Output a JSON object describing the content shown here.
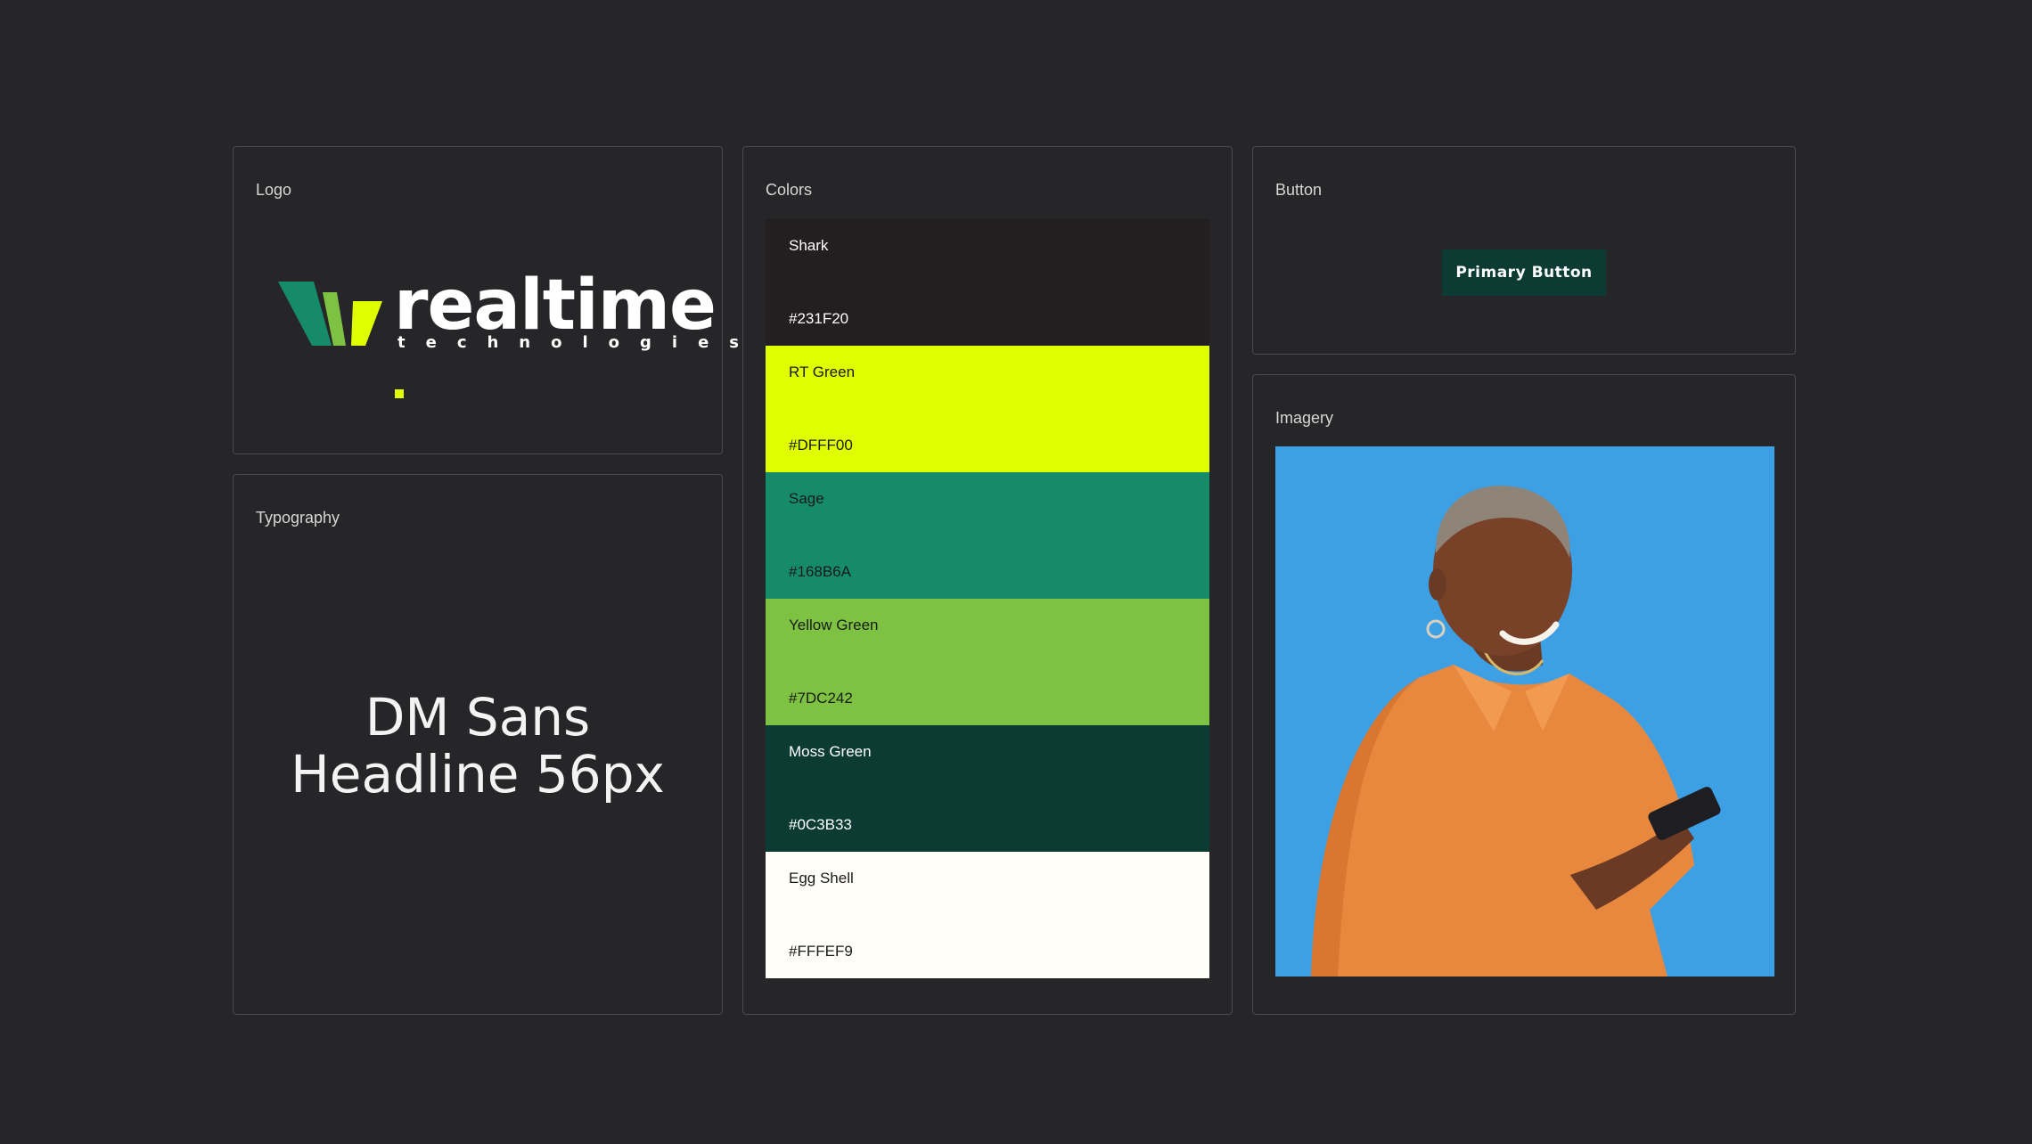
{
  "cards": {
    "logo": {
      "label": "Logo",
      "wordmark": "realtime",
      "subtext": "technologies"
    },
    "typography": {
      "label": "Typography",
      "line1": "DM Sans",
      "line2": "Headline 56px"
    },
    "colors": {
      "label": "Colors",
      "swatches": [
        {
          "name": "Shark",
          "hex": "#231F20",
          "text_color": "#ffffff"
        },
        {
          "name": "RT Green",
          "hex": "#DFFF00",
          "text_color": "#1a1a1a"
        },
        {
          "name": "Sage",
          "hex": "#168B6A",
          "text_color": "#1a1a1a"
        },
        {
          "name": "Yellow Green",
          "hex": "#7DC242",
          "text_color": "#1a1a1a"
        },
        {
          "name": "Moss Green",
          "hex": "#0C3B33",
          "text_color": "#ffffff"
        },
        {
          "name": "Egg Shell",
          "hex": "#FFFEF9",
          "text_color": "#1a1a1a"
        }
      ]
    },
    "button": {
      "label": "Button",
      "primary_label": "Primary Button"
    },
    "imagery": {
      "label": "Imagery",
      "background": "#3DA0E4"
    }
  },
  "colors": {
    "page_bg": "#262628",
    "card_border": "#4a4a4d",
    "logo_green_dark": "#168B6A",
    "logo_green_light": "#7DC242",
    "logo_yellow": "#DFFF00"
  }
}
